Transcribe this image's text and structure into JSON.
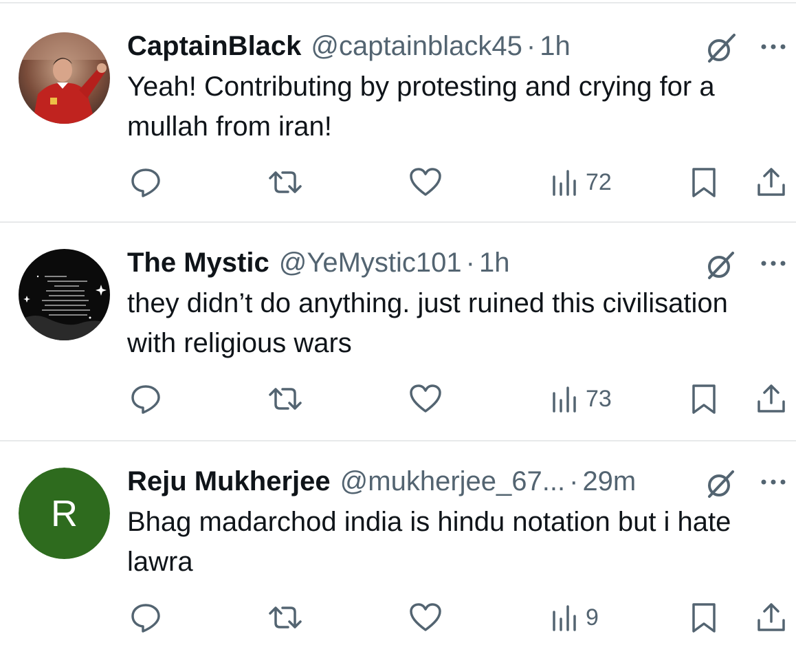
{
  "tweets": [
    {
      "name": "CaptainBlack",
      "handle": "@captainblack45",
      "separator": "·",
      "time": "1h",
      "text": "Yeah! Contributing by protesting and crying for a mullah from iran!",
      "views": "72",
      "avatar": {
        "type": "photo",
        "subject": "man-in-red-shirt"
      }
    },
    {
      "name": "The Mystic",
      "handle": "@YeMystic101",
      "separator": "·",
      "time": "1h",
      "text": "they didn’t do anything. just ruined this civilisation with religious wars",
      "views": "73",
      "avatar": {
        "type": "photo",
        "subject": "black-poem-image"
      }
    },
    {
      "name": "Reju Mukherjee",
      "handle": "@mukherjee_67...",
      "separator": "·",
      "time": "29m",
      "text": "Bhag madarchod india is hindu notation  but i hate lawra",
      "views": "9",
      "avatar": {
        "type": "letter",
        "letter": "R",
        "color": "#2e6b1e"
      }
    }
  ],
  "icons": {
    "reply": "reply-icon",
    "retweet": "retweet-icon",
    "like": "heart-icon",
    "views": "views-icon",
    "bookmark": "bookmark-icon",
    "share": "share-icon",
    "grok": "grok-icon",
    "more": "more-icon"
  },
  "colors": {
    "text": "#0f1419",
    "secondary": "#536471",
    "divider": "#e7e9ea",
    "avatar_r": "#2e6b1e"
  }
}
